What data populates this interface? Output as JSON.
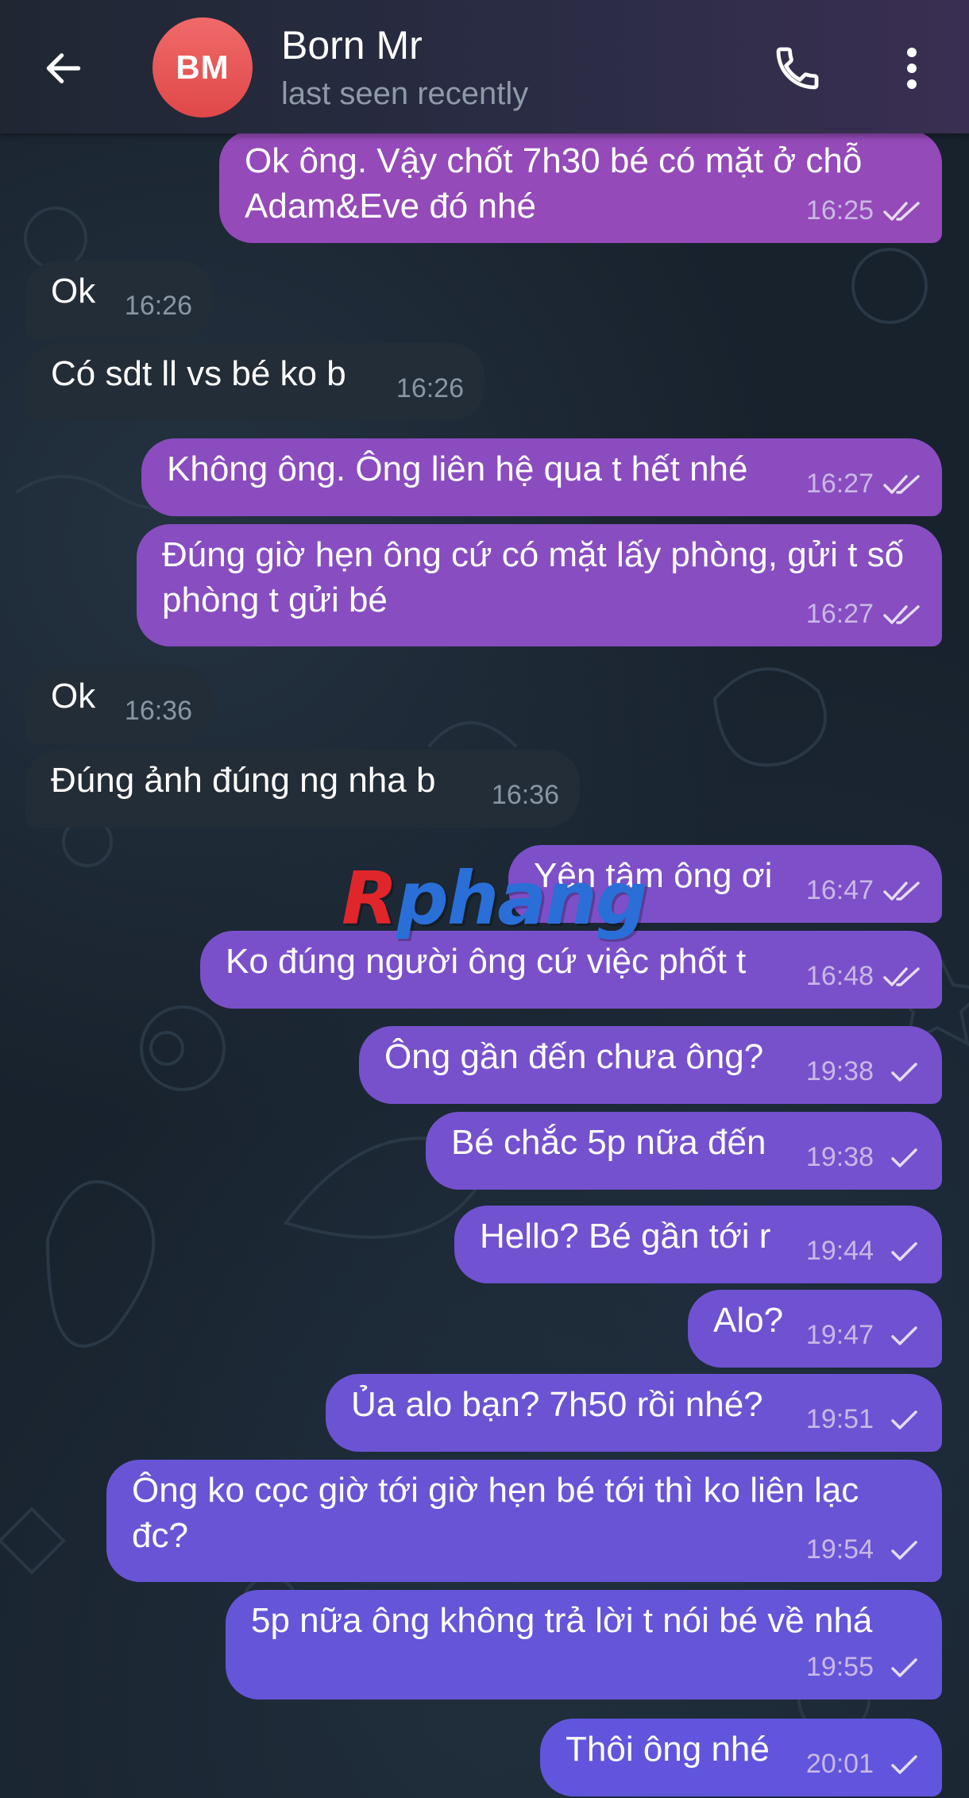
{
  "header": {
    "avatar_initials": "BM",
    "contact_name": "Born Mr",
    "status": "last seen recently"
  },
  "watermark": {
    "first": "R",
    "rest": "phang"
  },
  "messages": [
    {
      "dir": "out",
      "text": "Ok ông. Vậy chốt 7h30 bé có mặt ở chỗ Adam&Eve đó nhé",
      "time": "16:25",
      "ticks": "double"
    },
    {
      "dir": "in",
      "text": "Ok",
      "time": "16:26"
    },
    {
      "dir": "in",
      "text": "Có sdt ll vs bé ko b",
      "time": "16:26"
    },
    {
      "dir": "out",
      "text": "Không ông. Ông liên hệ qua t hết nhé",
      "time": "16:27",
      "ticks": "double"
    },
    {
      "dir": "out",
      "text": "Đúng giờ hẹn ông cứ có mặt lấy phòng, gửi t số phòng t gửi bé",
      "time": "16:27",
      "ticks": "double"
    },
    {
      "dir": "in",
      "text": "Ok",
      "time": "16:36"
    },
    {
      "dir": "in",
      "text": "Đúng ảnh đúng ng nha b",
      "time": "16:36"
    },
    {
      "dir": "out",
      "text": "Yên tâm ông ơi",
      "time": "16:47",
      "ticks": "double"
    },
    {
      "dir": "out",
      "text": "Ko đúng người ông cứ việc phốt t",
      "time": "16:48",
      "ticks": "double"
    },
    {
      "dir": "out",
      "text": "Ông gần đến chưa ông?",
      "time": "19:38",
      "ticks": "single"
    },
    {
      "dir": "out",
      "text": "Bé chắc 5p nữa đến",
      "time": "19:38",
      "ticks": "single"
    },
    {
      "dir": "out",
      "text": "Hello? Bé gần tới r",
      "time": "19:44",
      "ticks": "single"
    },
    {
      "dir": "out",
      "text": "Alo?",
      "time": "19:47",
      "ticks": "single"
    },
    {
      "dir": "out",
      "text": "Ủa alo bạn? 7h50 rồi nhé?",
      "time": "19:51",
      "ticks": "single"
    },
    {
      "dir": "out",
      "text": "Ông ko cọc giờ tới giờ hẹn bé tới thì ko liên lạc đc?",
      "time": "19:54",
      "ticks": "single"
    },
    {
      "dir": "out",
      "text": "5p nữa ông không trả lời t nói bé về nhá",
      "time": "19:55",
      "ticks": "single"
    },
    {
      "dir": "out",
      "text": "Thôi ông nhé",
      "time": "20:01",
      "ticks": "single"
    }
  ],
  "colors": {
    "outgoing_bubble": "#8244c7",
    "incoming_bubble": "#232d38",
    "avatar": "#e85454"
  }
}
